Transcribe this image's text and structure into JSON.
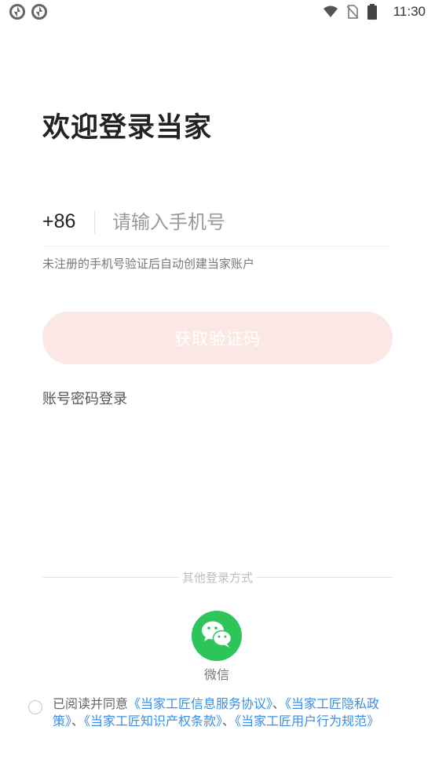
{
  "status_bar": {
    "time": "11:30",
    "left_icons": [
      "sync-icon",
      "sync-icon"
    ],
    "right_icons": [
      "wifi-icon",
      "no-sim-icon",
      "battery-icon"
    ]
  },
  "title": "欢迎登录当家",
  "phone": {
    "country_code": "+86",
    "placeholder": "请输入手机号",
    "value": ""
  },
  "hint": "未注册的手机号验证后自动创建当家账户",
  "get_code_button": "获取验证码",
  "password_login": "账号密码登录",
  "other_login": {
    "label": "其他登录方式",
    "wechat": {
      "icon": "wechat-icon",
      "label": "微信",
      "color": "#2dc45a"
    }
  },
  "agreement": {
    "checked": false,
    "prefix": "已阅读并同意",
    "links": [
      "《当家工匠信息服务协议》",
      "《当家工匠隐私政策》",
      "《当家工匠知识产权条款》",
      "《当家工匠用户行为规范》"
    ],
    "separator": "、"
  },
  "colors": {
    "accent_light": "#fbe7e4",
    "link": "#3a8ee6",
    "wechat": "#2dc45a"
  }
}
